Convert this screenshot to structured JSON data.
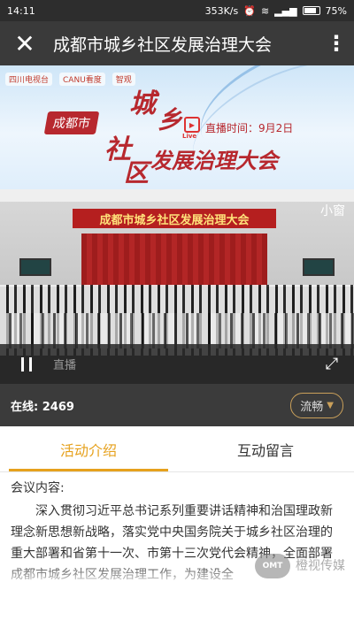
{
  "status_bar": {
    "time": "14:11",
    "speed": "353K/s",
    "battery": "75%"
  },
  "titlebar": {
    "title": "成都市城乡社区发展治理大会"
  },
  "banner": {
    "logos": [
      "四川电视台",
      "CANU看度",
      "智观"
    ],
    "tag": "成都市",
    "chars": [
      "城",
      "乡",
      "社",
      "区"
    ],
    "main_title": "发展治理大会",
    "live_icon": "Live",
    "live_time": "直播时间：9月2日"
  },
  "video": {
    "stage_banner": "成都市城乡社区发展治理大会",
    "mini_window": "小窗",
    "live_label": "直播",
    "online_label": "在线:",
    "online_count": "2469",
    "quality": "流畅"
  },
  "tabs": [
    {
      "label": "活动介绍",
      "active": true
    },
    {
      "label": "互动留言",
      "active": false
    }
  ],
  "content": {
    "heading": "会议内容:",
    "paragraph": "深入贯彻习近平总书记系列重要讲话精神和治国理政新理念新思想新战略，落实党中央国务院关于城乡社区治理的重大部署和省第十一次、市第十三次党代会精神，全面部署成都市城乡社区发展治理工作，为建设全"
  },
  "watermark": {
    "logo": "OMT",
    "text": "橙视传媒"
  }
}
